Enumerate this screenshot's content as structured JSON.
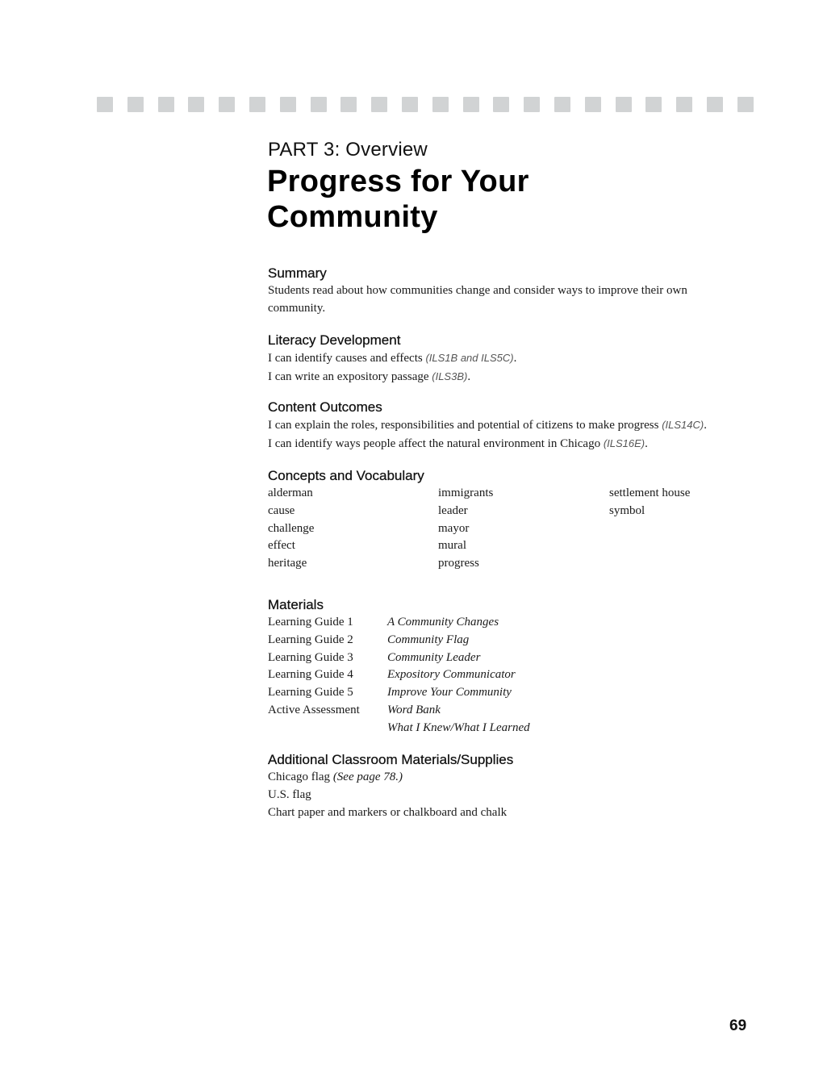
{
  "decoration": {
    "square_count": 22,
    "square_color": "#d1d3d4"
  },
  "header": {
    "part_label": "PART 3: Overview",
    "title_line1": "Progress for Your",
    "title_line2": "Community"
  },
  "summary": {
    "heading": "Summary",
    "lines": [
      "Students read about how communities change and consider ways to improve their own",
      "community."
    ]
  },
  "literacy": {
    "heading": "Literacy Development",
    "items": [
      {
        "text": "I can identify causes and effects ",
        "code": "(ILS1B and ILS5C)",
        "end": "."
      },
      {
        "text": "I can write an expository passage ",
        "code": "(ILS3B)",
        "end": "."
      }
    ]
  },
  "content": {
    "heading": "Content Outcomes",
    "items": [
      {
        "text": "I can explain the roles, responsibilities and potential of citizens to make progress ",
        "code": "(ILS14C)",
        "end": "."
      },
      {
        "text": "I can identify ways people affect the natural environment in Chicago ",
        "code": "(ILS16E)",
        "end": "."
      }
    ]
  },
  "vocabulary": {
    "heading": "Concepts and Vocabulary",
    "columns": [
      [
        "alderman",
        "cause",
        "challenge",
        "effect",
        "heritage"
      ],
      [
        "immigrants",
        "leader",
        "mayor",
        "mural",
        "progress"
      ],
      [
        "settlement house",
        "symbol"
      ]
    ]
  },
  "materials": {
    "heading": "Materials",
    "rows": [
      {
        "label": "Learning Guide 1",
        "title": "A Community Changes"
      },
      {
        "label": "Learning Guide 2",
        "title": "Community Flag"
      },
      {
        "label": "Learning Guide 3",
        "title": "Community Leader"
      },
      {
        "label": "Learning Guide 4",
        "title": "Expository Communicator"
      },
      {
        "label": "Learning Guide 5",
        "title": "Improve Your Community"
      },
      {
        "label": "Active Assessment",
        "title": "Word Bank"
      },
      {
        "label": "",
        "title": "What I Knew/What I Learned"
      }
    ]
  },
  "supplies": {
    "heading": "Additional Classroom Materials/Supplies",
    "items": [
      {
        "text": "Chicago flag ",
        "note": "(See page 78.)"
      },
      {
        "text": "U.S. flag",
        "note": ""
      },
      {
        "text": "Chart paper and markers or chalkboard and chalk",
        "note": ""
      }
    ]
  },
  "footer": {
    "page_number": "69"
  }
}
